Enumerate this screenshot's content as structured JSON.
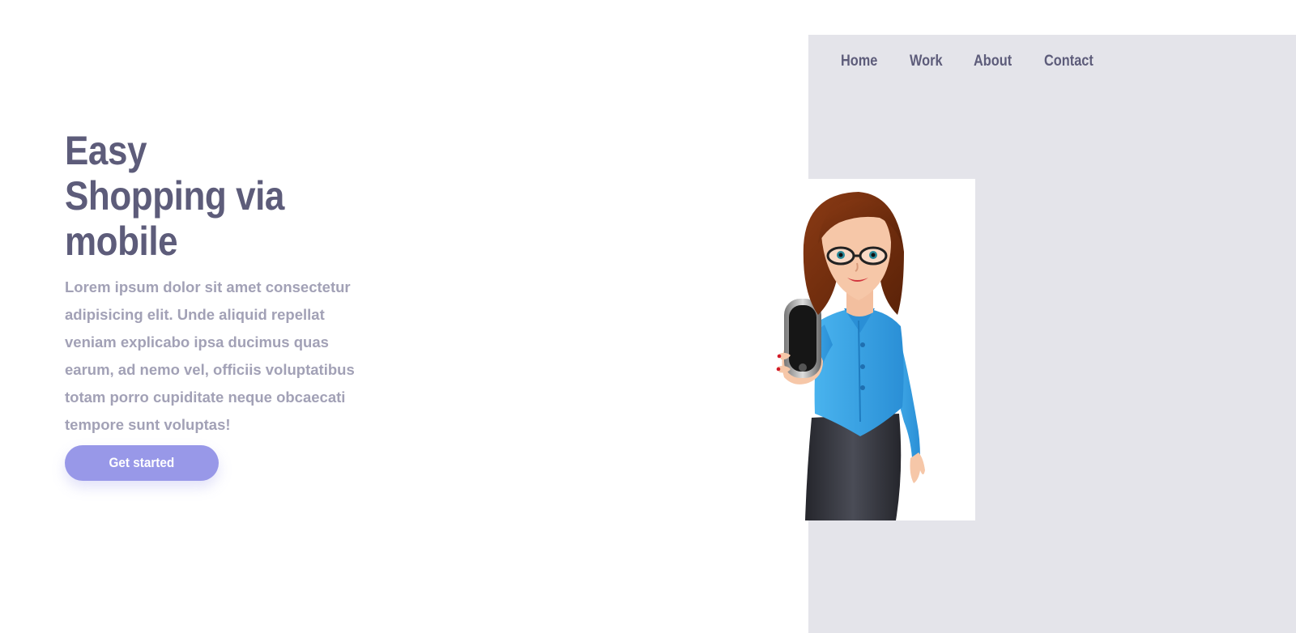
{
  "nav": {
    "items": [
      {
        "label": "Home"
      },
      {
        "label": "Work"
      },
      {
        "label": "About"
      },
      {
        "label": "Contact"
      }
    ]
  },
  "hero": {
    "title_lines": [
      "Easy",
      "Shopping via",
      "mobile"
    ],
    "description": "Lorem ipsum dolor sit amet consectetur adipisicing elit. Unde aliquid repellat veniam explicabo ipsa ducimus quas earum, ad nemo vel, officiis voluptatibus totam porro cupiditate neque obcaecati tempore sunt voluptas!",
    "cta_label": "Get started"
  },
  "colors": {
    "heading": "#5d5c7a",
    "body_text": "#a2a1b6",
    "accent": "#9898e8",
    "panel": "#e4e4ea"
  },
  "illustration": {
    "icon": "woman-holding-phone-illustration"
  }
}
